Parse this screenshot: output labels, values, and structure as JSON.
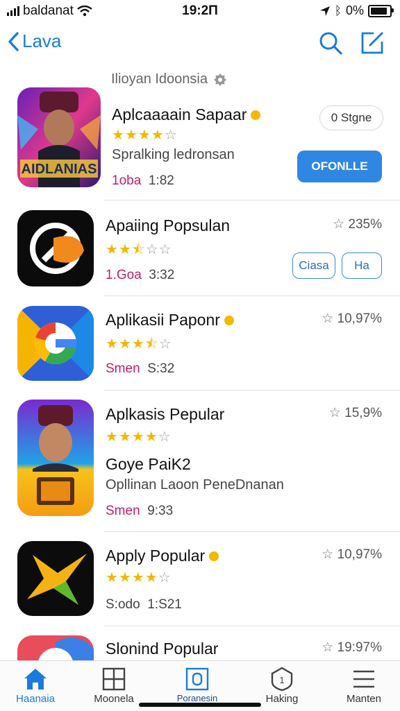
{
  "status_bar": {
    "carrier": "baldanat",
    "time": "19:2Π",
    "battery_text": "0%",
    "battery_level": 0.9
  },
  "nav": {
    "back_label": "Lava",
    "search_icon": "search-icon",
    "compose_icon": "compose-icon",
    "accent": "#1a7bdc"
  },
  "section": {
    "title": "Ilioyan Idoonsia"
  },
  "apps": [
    {
      "title": "Aplcaaaain Sapaar",
      "rating": 4,
      "subtitle": "Spralking ledronsan",
      "meta_a": "1oba",
      "meta_b": "1:82",
      "pill_label": "0 Stgne",
      "action_label": "OFONLLE"
    },
    {
      "title": "Apaiing Popsulan",
      "rating": 2.5,
      "percent": "235%",
      "meta_a": "1.Goa",
      "meta_b": "3:32",
      "btn1": "Ciasa",
      "btn2": "Ha"
    },
    {
      "title": "Aplikasii Paponr",
      "rating": 3.5,
      "percent": "10,97%",
      "meta_a": "Smen",
      "meta_b": "S:32"
    },
    {
      "title": "Aplkasis Pepular",
      "rating": 4,
      "percent": "15,9%",
      "line2": "Goye PaiK2",
      "line3": "Opllinan Laoon PeneDnanan",
      "meta_a": "Smen",
      "meta_b": "9:33"
    },
    {
      "title": "Apply Popular",
      "rating": 4,
      "percent": "10,97%",
      "meta_a": "S:odo",
      "meta_b": "1:S21"
    },
    {
      "title": "Slonind Popular",
      "percent": "19:97%"
    }
  ],
  "tabs": [
    {
      "label": "Haanaia",
      "icon": "home-icon"
    },
    {
      "label": "Moonela",
      "icon": "grid-icon"
    },
    {
      "label": "Poranesin",
      "icon": "box-icon"
    },
    {
      "label": "Haking",
      "icon": "shield-icon"
    },
    {
      "label": "Manten",
      "icon": "menu-icon"
    }
  ]
}
